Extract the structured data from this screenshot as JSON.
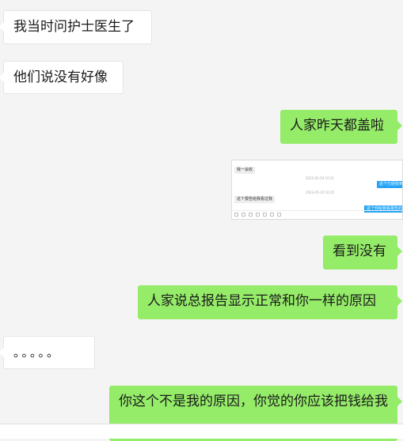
{
  "messages": {
    "m1": "我当时问护士医生了",
    "m2": "他们说没有好像",
    "m3": "人家昨天都盖啦",
    "m4": "看到没有",
    "m5": "人家说总报告显示正常和你一样的原因",
    "m6": "。。。。。",
    "m7": "你这个不是我的原因，你觉的你应该把钱给我"
  },
  "screenshot": {
    "left_1": "我一会收",
    "right_1": "这个已经收到",
    "left_2": "这个报告给我看过我",
    "right_2": "这个你给我看报告的",
    "time_1": "2023-05-20 10:21",
    "time_2": "2023-05-20 10:25"
  },
  "colors": {
    "background": "#f4f4f4",
    "incoming_bubble": "#ffffff",
    "outgoing_bubble": "#95ec69"
  }
}
